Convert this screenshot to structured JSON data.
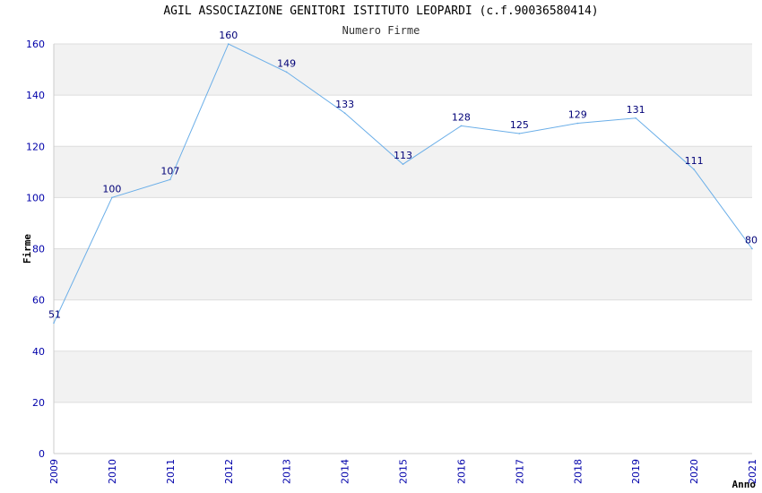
{
  "chart_data": {
    "type": "line",
    "title": "AGIL ASSOCIAZIONE GENITORI ISTITUTO LEOPARDI (c.f.90036580414)",
    "subtitle": "Numero Firme",
    "xlabel": "Anno",
    "ylabel": "Firme",
    "x": [
      "2009",
      "2010",
      "2011",
      "2012",
      "2013",
      "2014",
      "2015",
      "2016",
      "2017",
      "2018",
      "2019",
      "2020",
      "2021"
    ],
    "series": [
      {
        "values": [
          51,
          100,
          107,
          160,
          149,
          133,
          113,
          128,
          125,
          129,
          131,
          111,
          80
        ]
      }
    ],
    "ylim": [
      0,
      160
    ],
    "yticks": [
      0,
      20,
      40,
      60,
      80,
      100,
      120,
      140,
      160
    ],
    "grid": true,
    "legend": "none",
    "colors": {
      "line": "#6aaee8",
      "band": "#f2f2f2",
      "grid": "#dddddd",
      "tick_text": "#0000aa",
      "label_text": "#000077"
    }
  }
}
